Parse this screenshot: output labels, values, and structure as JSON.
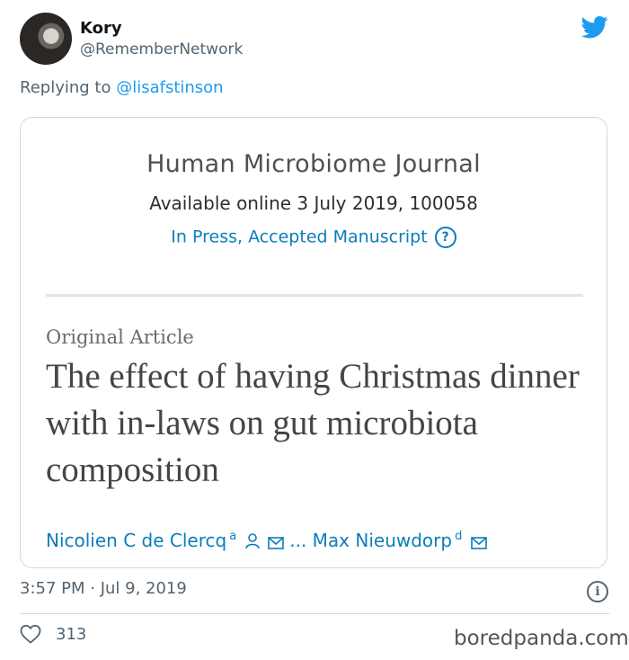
{
  "tweet": {
    "author_name": "Kory",
    "author_handle": "@RememberNetwork",
    "reply_prefix": "Replying to ",
    "reply_to": "@lisafstinson",
    "timestamp": "3:57 PM · Jul 9, 2019",
    "likes": "313",
    "brand_color": "#1d9bf0"
  },
  "article": {
    "journal": "Human Microbiome Journal",
    "availability": "Available online 3 July 2019, 100058",
    "status": "In Press, Accepted Manuscript",
    "section": "Original Article",
    "title": "The effect of having Christmas dinner with in-laws on gut microbiota composition",
    "author1": "Nicolien C de Clercq",
    "author1_sup": "a",
    "ellipsis": "...",
    "author2": "Max Nieuwdorp",
    "author2_sup": "d",
    "link_color": "#0c7dbb"
  },
  "watermark": "boredpanda.com"
}
